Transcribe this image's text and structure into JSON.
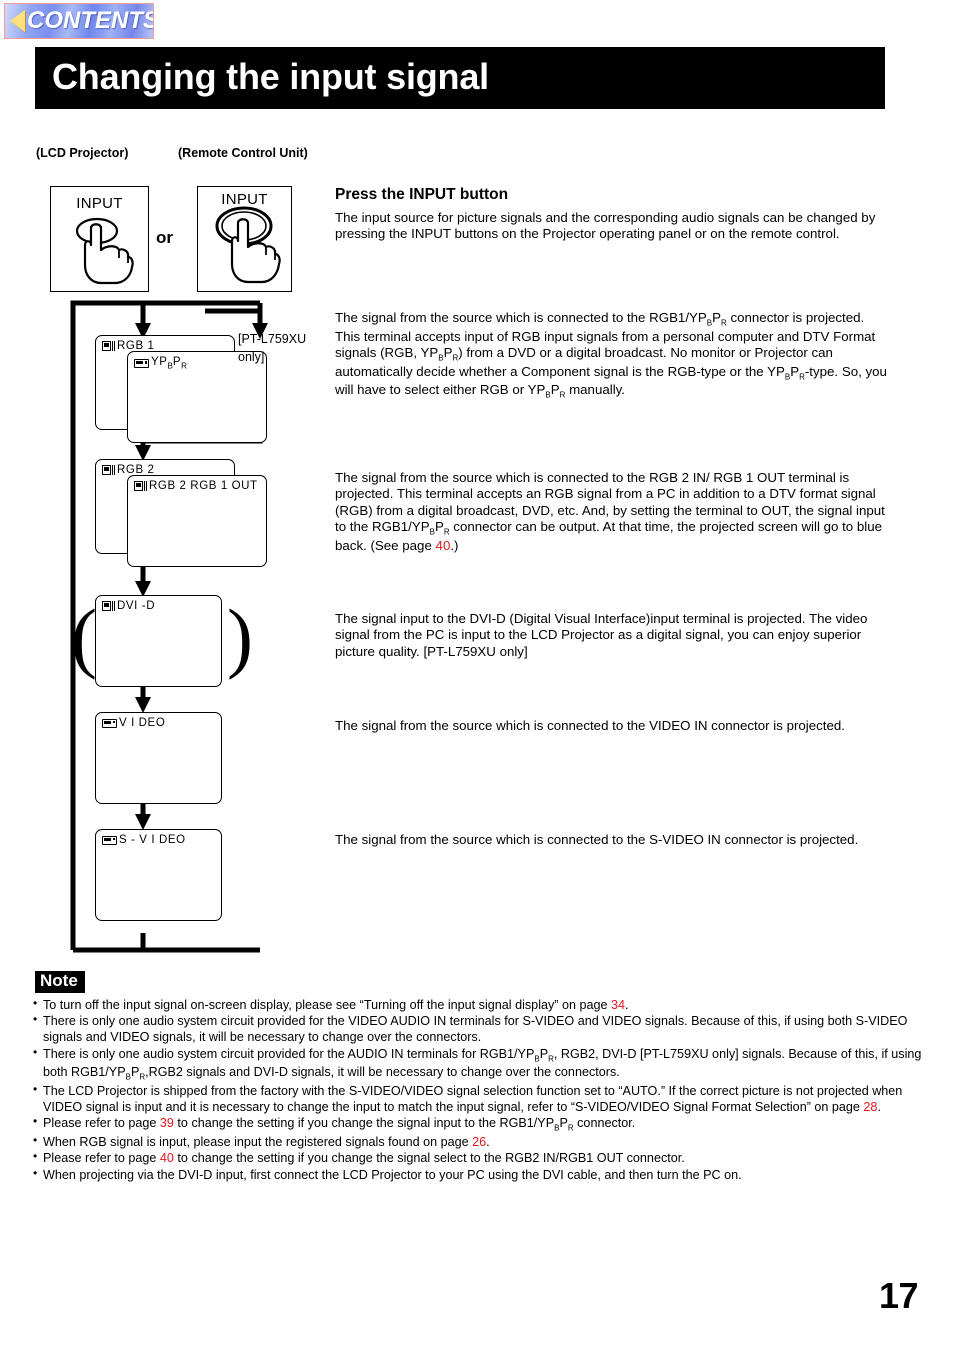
{
  "contents_button": {
    "label": "CONTENTS",
    "icon": "left-triangle-icon"
  },
  "header": {
    "title": "Changing the input signal"
  },
  "figures": {
    "lcd_caption": "(LCD Projector)",
    "remote_caption": "(Remote Control Unit)",
    "lcd_button_label": "INPUT",
    "remote_button_label": "INPUT",
    "or_label": "or"
  },
  "flow": {
    "boxes": [
      {
        "id": "rgb1",
        "label": "RGB 1",
        "icon": "computer-icon"
      },
      {
        "id": "ypbpr",
        "label": "YPBPR",
        "icon": "video-deck-icon",
        "label_main": "YP",
        "label_sub1": "B",
        "label_mid": "P",
        "label_sub2": "R"
      },
      {
        "id": "rgb2",
        "label": "RGB 2",
        "icon": "computer-icon"
      },
      {
        "id": "rgb2out",
        "label": "RGB 2   RGB 1 OUT",
        "icon": "computer-icon"
      },
      {
        "id": "dvid",
        "label": "DVI -D",
        "icon": "computer-icon"
      },
      {
        "id": "video",
        "label": "V I DEO",
        "icon": "video-deck-icon"
      },
      {
        "id": "svideo",
        "label": "S - V I DEO",
        "icon": "video-deck-icon"
      }
    ],
    "model_note": "[PT-L759XU only]"
  },
  "main": {
    "heading": "Press the INPUT button",
    "intro": "The input source for picture signals and the corresponding audio signals can be changed by pressing the INPUT buttons on the Projector operating panel or on the remote control.",
    "rgb1_line1": "The signal from the source which is connected to the RGB1/YP",
    "rgb1_line1b": "B",
    "rgb1_line1c": "P",
    "rgb1_line1d": "R",
    "rgb1_rest": " connector is projected. This terminal accepts input of RGB input signals from a personal computer and DTV Format signals (RGB, YP",
    "rgb1_rest2": ") from a DVD or a digital broadcast. No monitor or Projector can automatically decide whether a Component signal is the RGB-type or the YP",
    "rgb1_rest3": "-type. So, you will have to select either RGB or YP",
    "rgb1_rest4": " manually.",
    "rgb2_a": "The signal from the source which is connected to the RGB 2 IN/ RGB 1 OUT terminal is projected. This terminal accepts an RGB signal from a PC in addition to a DTV format signal (RGB) from a digital broadcast, DVD, etc. And, by setting the terminal to OUT, the signal input to the RGB1/YP",
    "rgb2_b": " connector can be output. At that time, the projected screen will go to blue back. (See page ",
    "rgb2_page": "40",
    "rgb2_c": ".)",
    "dvi": "The signal input to the DVI-D (Digital Visual Interface)input terminal is projected. The video signal from the PC is input to the LCD Projector as a digital signal, you can enjoy superior picture quality. [PT-L759XU only]",
    "video": "The signal from the source which is connected to the VIDEO IN connector is projected.",
    "svideo": "The signal from the source which is connected to the S-VIDEO IN connector is projected."
  },
  "note": {
    "badge": "Note",
    "items": [
      {
        "text_a": "To turn off the input signal on-screen display, please see “Turning off the input signal display” on page ",
        "page": "34",
        "text_b": "."
      },
      {
        "text_a": "There is only one audio system circuit provided for the VIDEO AUDIO IN terminals for S-VIDEO and  VIDEO signals. Because of this, if using both S-VIDEO signals and VIDEO signals, it will be necessary to change over the connectors."
      },
      {
        "text_a": "There is only one audio system circuit provided for the AUDIO IN terminals for RGB1/YP",
        "text_b": ", RGB2, DVI-D [PT-L759XU only] signals. Because of this, if using both RGB1/YP",
        "text_c": ",RGB2 signals and DVI-D signals, it will be necessary to change over the connectors."
      },
      {
        "text_a": "The LCD Projector is shipped from the factory with the S-VIDEO/VIDEO signal selection function set to “AUTO.” If the correct picture is not projected when VIDEO signal is input and it is necessary to change the input to match the input signal, refer to “S-VIDEO/VIDEO Signal Format Selection” on page ",
        "page": "28",
        "text_b": "."
      },
      {
        "text_a": "Please refer to page ",
        "page": "39",
        "text_b": " to change the setting if you change the signal input to the RGB1/YP",
        "text_c": " connector."
      },
      {
        "text_a": "When RGB signal is input, please input the registered signals found on page ",
        "page": "26",
        "text_b": "."
      },
      {
        "text_a": "Please refer to page ",
        "page": "40",
        "text_b": " to change the setting if you change the signal select to the RGB2 IN/RGB1 OUT connector."
      },
      {
        "text_a": "When projecting via the DVI-D input, first connect the LCD Projector to your PC using the DVI cable, and then turn the PC on."
      }
    ]
  },
  "footer": {
    "page_number": "17"
  },
  "colors": {
    "accent_red": "#e8171f",
    "header_bg": "#000000",
    "contents_border": "#f49a9a"
  }
}
